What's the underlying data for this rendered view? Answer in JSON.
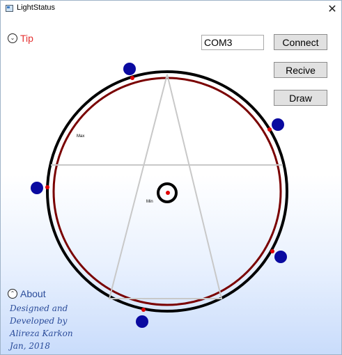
{
  "window": {
    "title": "LightStatus",
    "close_glyph": "✕",
    "icon": "app-window-icon"
  },
  "tip": {
    "label": "Tip",
    "icon": "chevron-down-circle-icon",
    "glyph": "⌄",
    "color": "#e53030"
  },
  "about": {
    "label": "About",
    "icon": "chevron-up-circle-icon",
    "glyph": "⌃",
    "color": "#2b4c9a"
  },
  "port": {
    "value": "COM3"
  },
  "buttons": {
    "connect": "Connect",
    "receive": "Recive",
    "draw": "Draw"
  },
  "diagram": {
    "max_label": "Max",
    "min_label": "Min",
    "sensor_color": "#0a0aa0",
    "marker_color": "#e00000",
    "inner_ring_color": "#7a0000",
    "outer_ring_color": "#000000",
    "polygon_color": "#c8c8c8"
  },
  "credits": {
    "line1": "Designed and",
    "line2": "Developed by",
    "line3": "Alireza Karkon",
    "line4": "Jan, 2018"
  }
}
